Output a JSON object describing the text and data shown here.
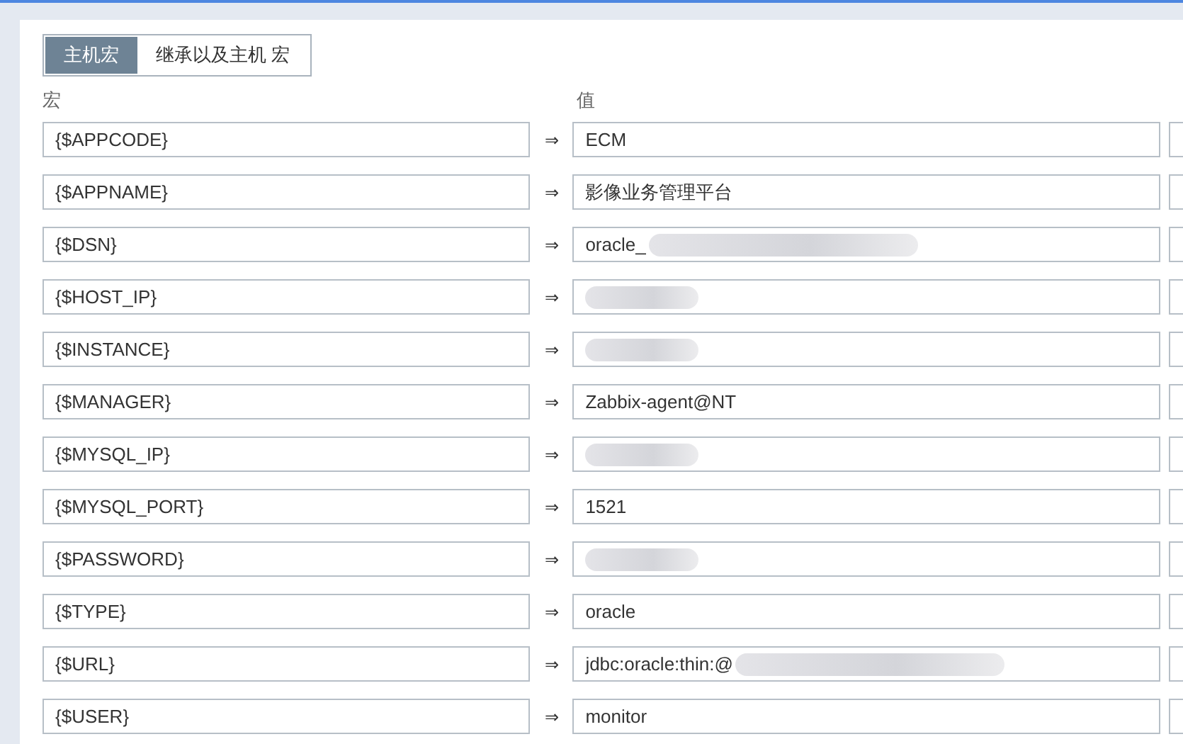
{
  "tabs": [
    {
      "label": "主机宏",
      "selected": true
    },
    {
      "label": "继承以及主机 宏",
      "selected": false
    }
  ],
  "columns": {
    "macro": "宏",
    "value": "值"
  },
  "rows": [
    {
      "macro": "{$APPCODE}",
      "arrow": "⇒",
      "value": "ECM",
      "redacted": false
    },
    {
      "macro": "{$APPNAME}",
      "arrow": "⇒",
      "value": "影像业务管理平台",
      "redacted": false
    },
    {
      "macro": "{$DSN}",
      "arrow": "⇒",
      "value": "oracle_",
      "redacted": true
    },
    {
      "macro": "{$HOST_IP}",
      "arrow": "⇒",
      "redacted": true
    },
    {
      "macro": "{$INSTANCE}",
      "arrow": "⇒",
      "redacted": true
    },
    {
      "macro": "{$MANAGER}",
      "arrow": "⇒",
      "value": "Zabbix-agent@NT",
      "redacted": false
    },
    {
      "macro": "{$MYSQL_IP}",
      "arrow": "⇒",
      "redacted": true
    },
    {
      "macro": "{$MYSQL_PORT}",
      "arrow": "⇒",
      "value": "1521",
      "redacted": false
    },
    {
      "macro": "{$PASSWORD}",
      "arrow": "⇒",
      "redacted": true
    },
    {
      "macro": "{$TYPE}",
      "arrow": "⇒",
      "value": "oracle",
      "redacted": false
    },
    {
      "macro": "{$URL}",
      "arrow": "⇒",
      "value": "jdbc:oracle:thin:@",
      "redacted": true
    },
    {
      "macro": "{$USER}",
      "arrow": "⇒",
      "value": "monitor",
      "redacted": false
    }
  ]
}
